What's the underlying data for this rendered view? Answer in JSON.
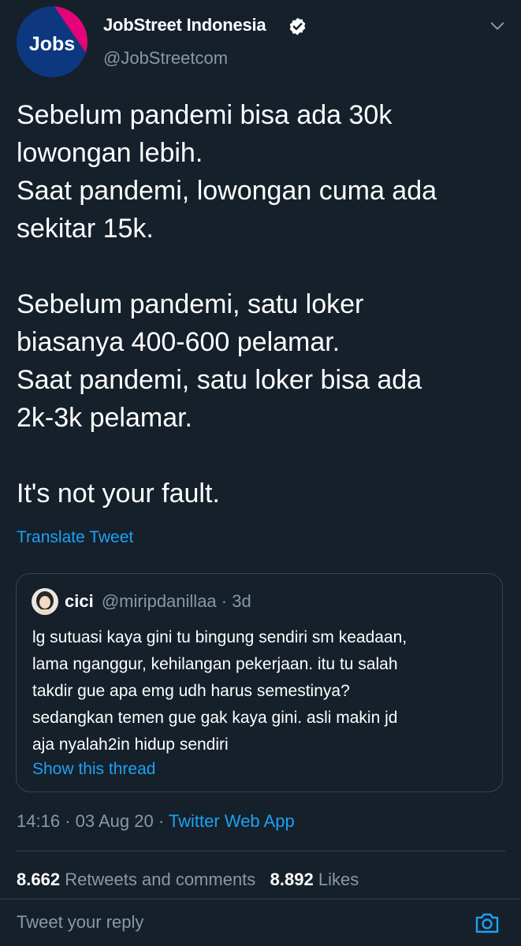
{
  "author": {
    "name": "JobStreet Indonesia",
    "handle": "@JobStreetcom",
    "avatar_text": "Jobs",
    "verified": true
  },
  "tweet": {
    "lines_1": [
      "Sebelum pandemi bisa ada 30k",
      "lowongan lebih.",
      "Saat pandemi, lowongan cuma ada",
      "sekitar 15k."
    ],
    "lines_2": [
      "Sebelum pandemi, satu loker",
      "biasanya 400-600 pelamar.",
      "Saat pandemi, satu loker bisa ada",
      "2k-3k pelamar."
    ],
    "lines_3": [
      "It's not your fault."
    ],
    "translate_label": "Translate Tweet"
  },
  "quote": {
    "name": "cici",
    "meta": "@miripdanillaa · 3d",
    "text_lines": [
      "lg sutuasi kaya gini tu bingung sendiri sm keadaan,",
      "lama nganggur, kehilangan pekerjaan. itu tu salah",
      "takdir gue apa emg udh harus semestinya?",
      "sedangkan temen gue gak kaya gini. asli makin jd",
      "aja nyalah2in hidup sendiri"
    ],
    "show_thread": "Show this thread"
  },
  "meta": {
    "time": "14:16",
    "date": "03 Aug 20",
    "sep": "·",
    "source": "Twitter Web App"
  },
  "stats": {
    "retweets_count": "8.662",
    "retweets_label": "Retweets and comments",
    "likes_count": "8.892",
    "likes_label": "Likes"
  },
  "reply": {
    "placeholder": "Tweet your reply"
  },
  "colors": {
    "background": "#15202b",
    "accent": "#1da1f2",
    "muted": "#8899a6",
    "border": "#38444d",
    "logo_blue": "#0d3880",
    "logo_pink": "#e60278"
  },
  "icons": [
    "verified-badge-icon",
    "chevron-down-icon",
    "camera-icon"
  ]
}
